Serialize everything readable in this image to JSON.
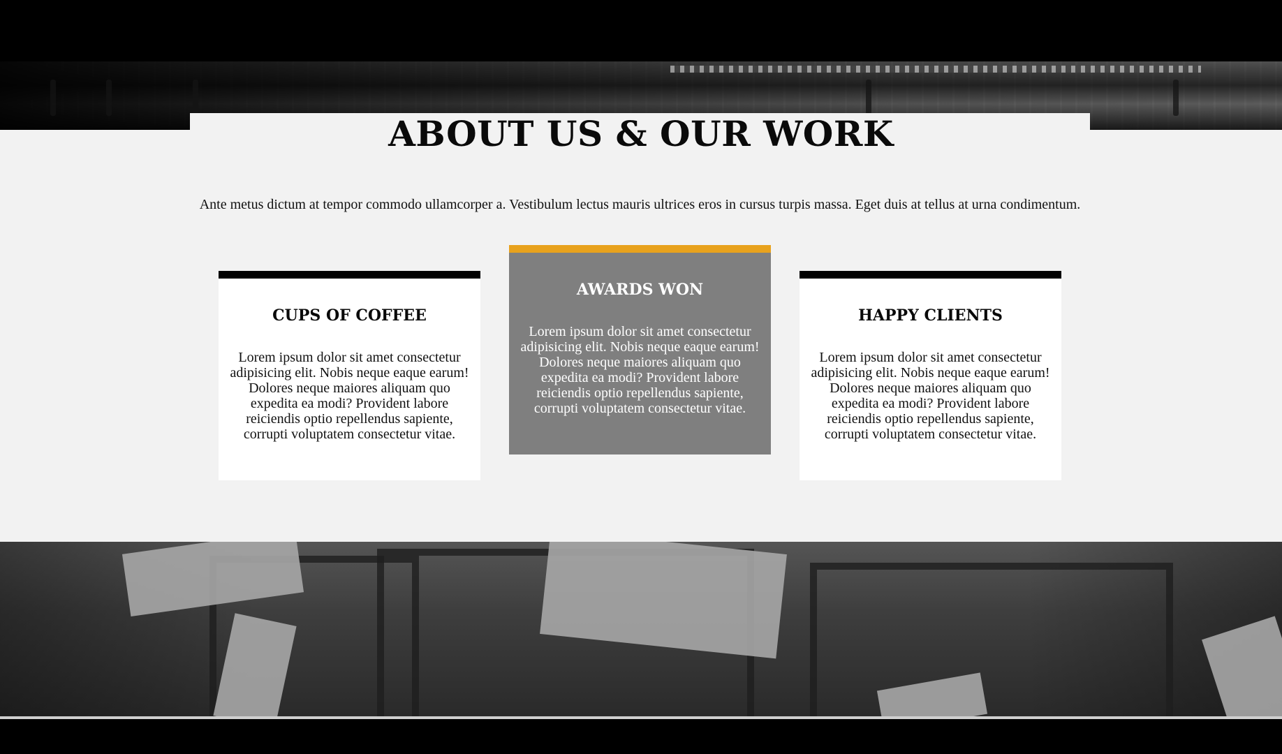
{
  "about": {
    "title": "ABOUT US & OUR WORK",
    "intro": "Ante metus dictum at tempor commodo ullamcorper a. Vestibulum lectus mauris ultrices eros in cursus turpis massa. Eget duis at tellus at urna condimentum."
  },
  "cards": [
    {
      "title": "CUPS OF COFFEE",
      "body": "Lorem ipsum dolor sit amet consectetur adipisicing elit. Nobis neque eaque earum! Dolores neque maiores aliquam quo expedita ea modi? Provident labore reiciendis optio repellendus sapiente, corrupti voluptatem consectetur vitae."
    },
    {
      "title": "AWARDS WON",
      "body": "Lorem ipsum dolor sit amet consectetur adipisicing elit. Nobis neque eaque earum! Dolores neque maiores aliquam quo expedita ea modi? Provident labore reiciendis optio repellendus sapiente, corrupti voluptatem consectetur vitae."
    },
    {
      "title": "HAPPY CLIENTS",
      "body": "Lorem ipsum dolor sit amet consectetur adipisicing elit. Nobis neque eaque earum! Dolores neque maiores aliquam quo expedita ea modi? Provident labore reiciendis optio repellendus sapiente, corrupti voluptatem consectetur vitae."
    }
  ],
  "colors": {
    "accent": "#e8a21d",
    "card_default_bar": "#000000",
    "card_highlight_bg": "#7f7f7f",
    "section_bg": "#f2f2f2"
  }
}
